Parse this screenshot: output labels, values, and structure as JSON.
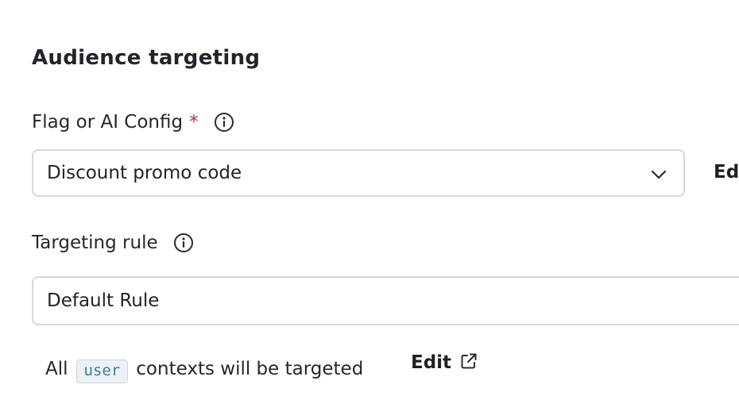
{
  "section": {
    "title": "Audience targeting"
  },
  "flag_field": {
    "label": "Flag or AI Config",
    "required_marker": "*",
    "selected_value": "Discount promo code",
    "edit_label_partial": "Ed"
  },
  "rule_field": {
    "label": "Targeting rule",
    "value": "Default Rule"
  },
  "summary": {
    "prefix": "All",
    "context_kind": "user",
    "suffix": "contexts will be targeted",
    "edit_label": "Edit"
  },
  "icons": {
    "info": "info-circle-icon",
    "dropdown": "chevron-down-icon",
    "external": "external-link-icon"
  },
  "colors": {
    "required": "#d1243f",
    "border": "#d8d8dd",
    "code_text": "#3a7fa0",
    "code_bg": "#eef1f4"
  }
}
